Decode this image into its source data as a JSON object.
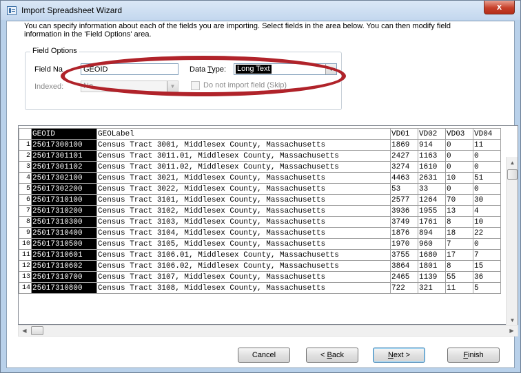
{
  "window": {
    "title": "Import Spreadsheet Wizard",
    "close_glyph": "x"
  },
  "instructions": "You can specify information about each of the fields you are importing. Select fields in the area below. You can then modify field information in the 'Field Options' area.",
  "field_options": {
    "group_title": "Field Options",
    "field_name_label": "Field Na",
    "field_name_value": "GEOID",
    "data_type_label_pre": "Data ",
    "data_type_label_u": "T",
    "data_type_label_post": "ype:",
    "data_type_value": "Long Text",
    "indexed_label": "Indexed:",
    "indexed_value": "No",
    "skip_label": "Do not import field (Skip)"
  },
  "grid": {
    "columns": [
      "GEOID",
      "GEOLabel",
      "VD01",
      "VD02",
      "VD03",
      "VD04"
    ],
    "rows": [
      [
        "1",
        "25017300100",
        "Census Tract 3001, Middlesex County, Massachusetts",
        "1869",
        "914",
        "0",
        "11"
      ],
      [
        "2",
        "25017301101",
        "Census Tract 3011.01, Middlesex County, Massachusetts",
        "2427",
        "1163",
        "0",
        "0"
      ],
      [
        "3",
        "25017301102",
        "Census Tract 3011.02, Middlesex County, Massachusetts",
        "3274",
        "1610",
        "0",
        "0"
      ],
      [
        "4",
        "25017302100",
        "Census Tract 3021, Middlesex County, Massachusetts",
        "4463",
        "2631",
        "10",
        "51"
      ],
      [
        "5",
        "25017302200",
        "Census Tract 3022, Middlesex County, Massachusetts",
        "53",
        "33",
        "0",
        "0"
      ],
      [
        "6",
        "25017310100",
        "Census Tract 3101, Middlesex County, Massachusetts",
        "2577",
        "1264",
        "70",
        "30"
      ],
      [
        "7",
        "25017310200",
        "Census Tract 3102, Middlesex County, Massachusetts",
        "3936",
        "1955",
        "13",
        "4"
      ],
      [
        "8",
        "25017310300",
        "Census Tract 3103, Middlesex County, Massachusetts",
        "3749",
        "1761",
        "8",
        "10"
      ],
      [
        "9",
        "25017310400",
        "Census Tract 3104, Middlesex County, Massachusetts",
        "1876",
        "894",
        "18",
        "22"
      ],
      [
        "10",
        "25017310500",
        "Census Tract 3105, Middlesex County, Massachusetts",
        "1970",
        "960",
        "7",
        "0"
      ],
      [
        "11",
        "25017310601",
        "Census Tract 3106.01, Middlesex County, Massachusetts",
        "3755",
        "1680",
        "17",
        "7"
      ],
      [
        "12",
        "25017310602",
        "Census Tract 3106.02, Middlesex County, Massachusetts",
        "3864",
        "1801",
        "8",
        "15"
      ],
      [
        "13",
        "25017310700",
        "Census Tract 3107, Middlesex County, Massachusetts",
        "2465",
        "1139",
        "55",
        "36"
      ],
      [
        "14",
        "25017310800",
        "Census Tract 3108, Middlesex County, Massachusetts",
        "722",
        "321",
        "11",
        "5"
      ]
    ]
  },
  "buttons": {
    "cancel": "Cancel",
    "back_pre": "< ",
    "back_u": "B",
    "back_post": "ack",
    "next_u": "N",
    "next_post": "ext >",
    "finish_u": "F",
    "finish_post": "inish"
  },
  "colors": {
    "highlight_oval": "#b0232a",
    "selected_column_bg": "#000000",
    "window_frame": "#b9d1ea"
  }
}
